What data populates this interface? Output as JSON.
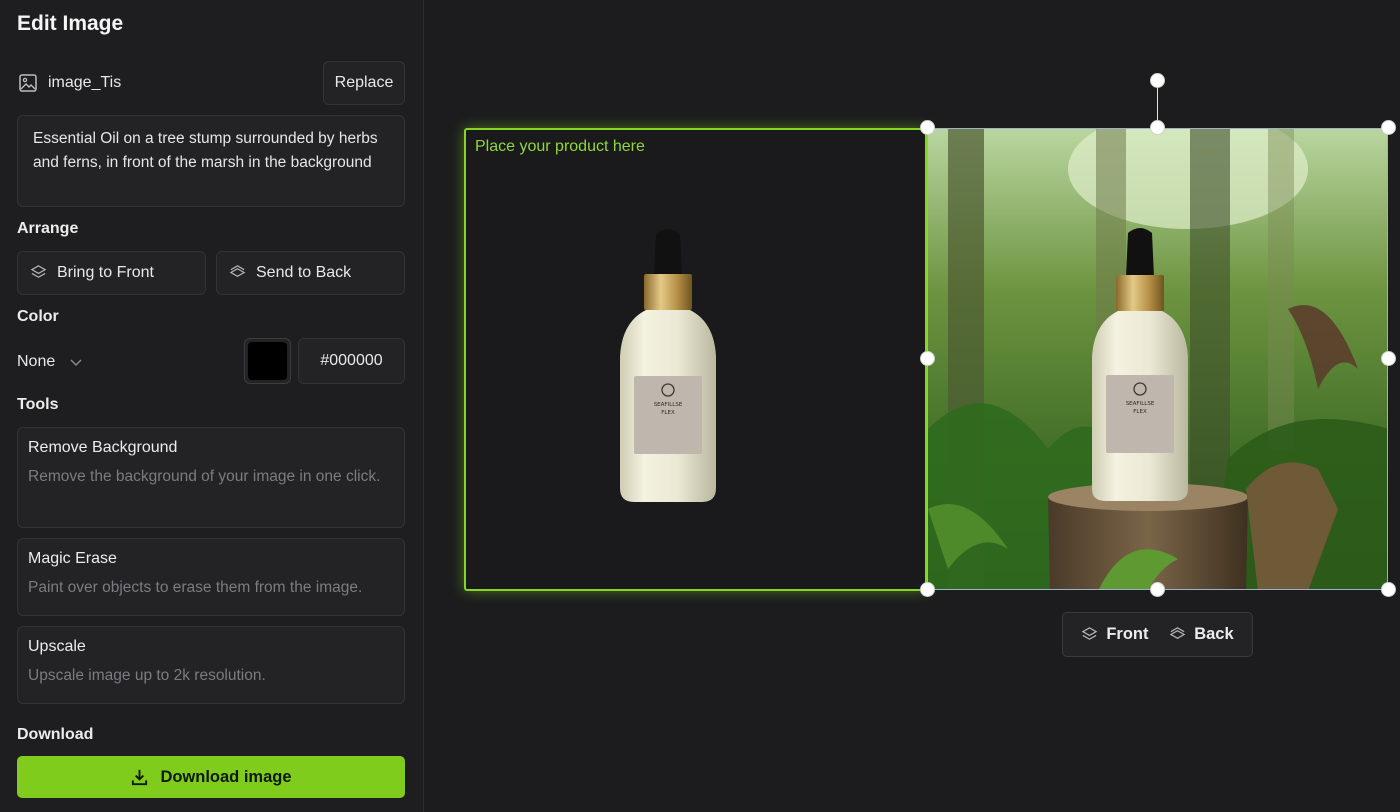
{
  "panel": {
    "title": "Edit Image",
    "file": {
      "name": "image_Tis",
      "replace_label": "Replace"
    },
    "prompt": "Essential Oil on a tree stump surrounded by herbs and ferns, in front of the marsh in the background",
    "arrange": {
      "label": "Arrange",
      "bring_front": "Bring to Front",
      "send_back": "Send to Back"
    },
    "color": {
      "label": "Color",
      "mode": "None",
      "swatch": "#000000",
      "hex": "#000000"
    },
    "tools": {
      "label": "Tools",
      "items": [
        {
          "title": "Remove Background",
          "desc": "Remove the background of your image in one click."
        },
        {
          "title": "Magic Erase",
          "desc": "Paint over objects to erase them from the image."
        },
        {
          "title": "Upscale",
          "desc": "Upscale image up to 2k resolution."
        }
      ]
    },
    "download": {
      "label": "Download",
      "button": "Download image"
    }
  },
  "canvas": {
    "placeholder_text": "Place your product here",
    "label_text_line1": "SEAFILLSE",
    "label_text_line2": "FLEX",
    "toolbar": {
      "front": "Front",
      "back": "Back"
    },
    "accent": "#84d61e"
  }
}
